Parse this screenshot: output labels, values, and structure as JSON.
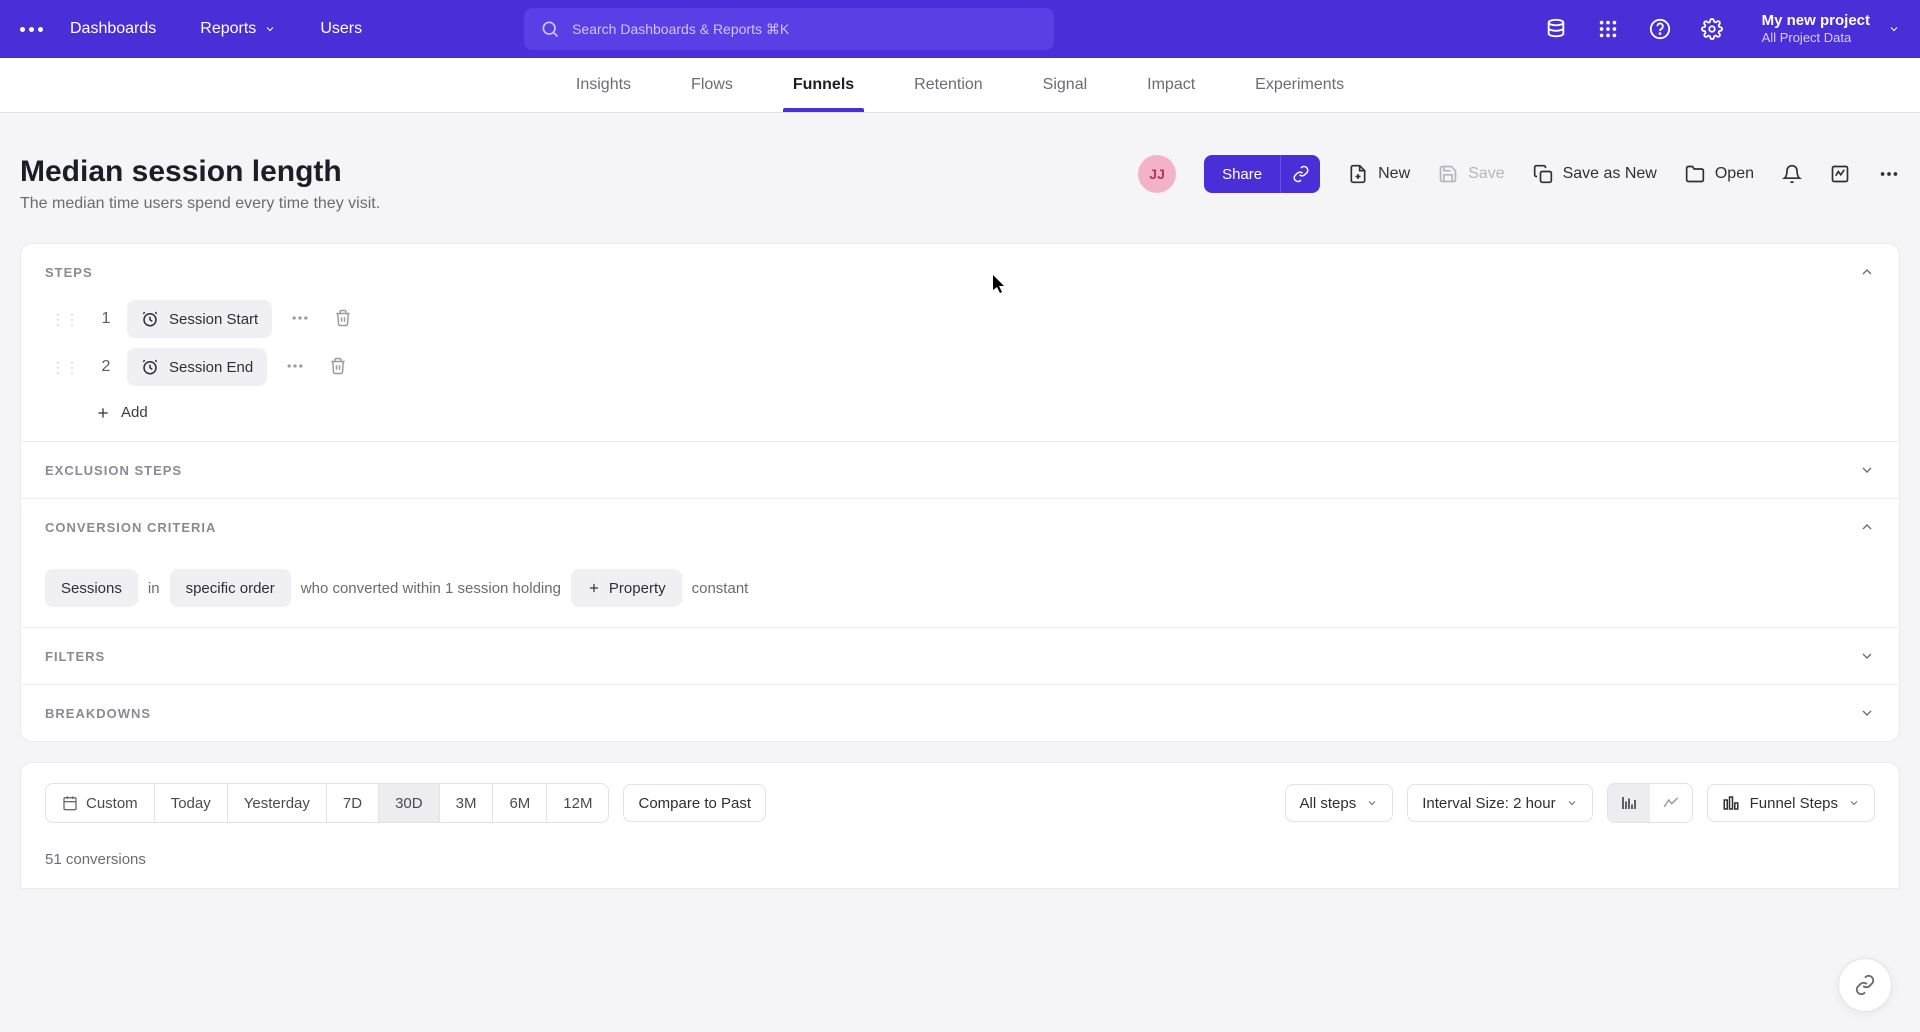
{
  "topnav": {
    "dashboards": "Dashboards",
    "reports": "Reports",
    "users": "Users",
    "search_placeholder": "Search Dashboards & Reports ⌘K",
    "project_name": "My new project",
    "project_sub": "All Project Data"
  },
  "subnav": {
    "insights": "Insights",
    "flows": "Flows",
    "funnels": "Funnels",
    "retention": "Retention",
    "signal": "Signal",
    "impact": "Impact",
    "experiments": "Experiments"
  },
  "page": {
    "title": "Median session length",
    "subtitle": "The median time users spend every time they visit.",
    "avatar": "JJ",
    "share": "Share",
    "new": "New",
    "save": "Save",
    "save_as_new": "Save as New",
    "open": "Open"
  },
  "sections": {
    "steps_header": "STEPS",
    "exclusion_header": "EXCLUSION STEPS",
    "conversion_header": "CONVERSION CRITERIA",
    "filters_header": "FILTERS",
    "breakdowns_header": "BREAKDOWNS",
    "step1_num": "1",
    "step1_label": "Session Start",
    "step2_num": "2",
    "step2_label": "Session End",
    "add_label": "Add"
  },
  "criteria": {
    "sessions": "Sessions",
    "in": "in",
    "order": "specific order",
    "who": "who converted within 1 session holding",
    "property": "Property",
    "constant": "constant"
  },
  "bottom": {
    "custom": "Custom",
    "today": "Today",
    "yesterday": "Yesterday",
    "d7": "7D",
    "d30": "30D",
    "m3": "3M",
    "m6": "6M",
    "m12": "12M",
    "compare": "Compare to Past",
    "all_steps": "All steps",
    "interval": "Interval Size: 2 hour",
    "funnel_steps": "Funnel Steps",
    "conversions": "51 conversions"
  }
}
